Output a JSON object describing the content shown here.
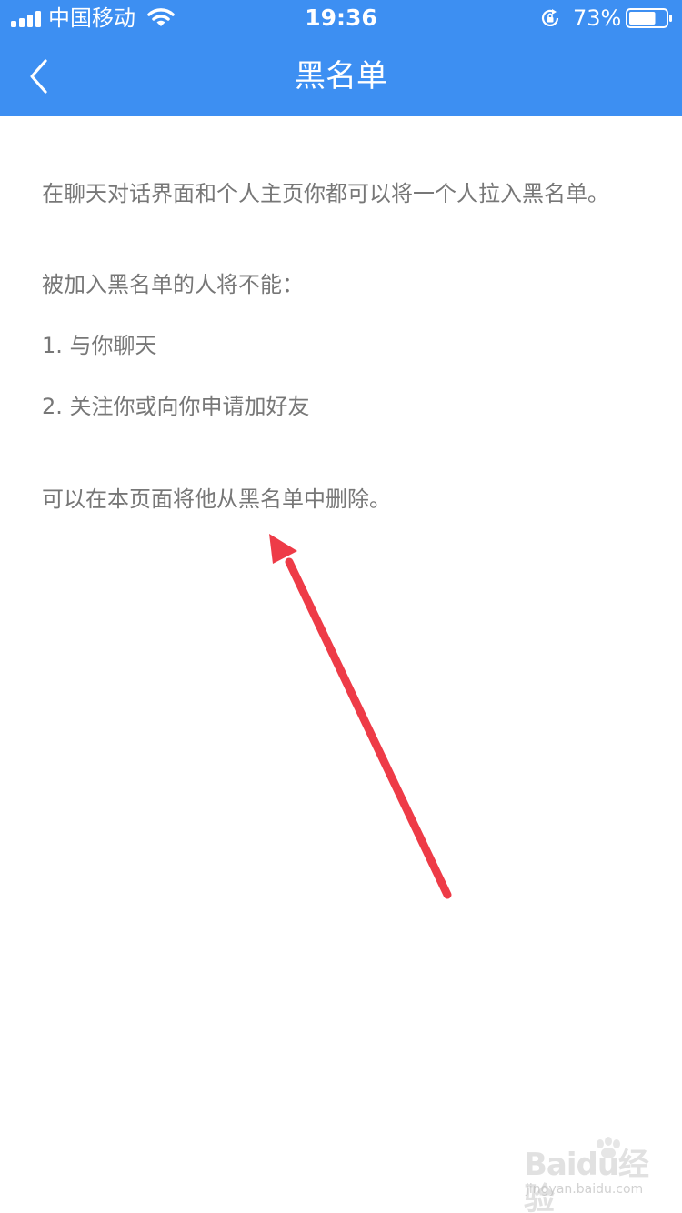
{
  "status_bar": {
    "carrier": "中国移动",
    "time": "19:36",
    "battery_percent": "73%",
    "battery_level": 0.73,
    "icons": [
      "signal-icon",
      "wifi-icon",
      "rotation-lock-icon",
      "battery-icon"
    ]
  },
  "nav": {
    "title": "黑名单",
    "back_icon": "chevron-left-icon"
  },
  "content": {
    "intro": "在聊天对话界面和个人主页你都可以将一个人拉入黑名单。",
    "restrictions_heading": "被加入黑名单的人将不能：",
    "restrictions": [
      "1. 与你聊天",
      "2. 关注你或向你申请加好友"
    ],
    "removal_note": "可以在本页面将他从黑名单中删除。"
  },
  "annotation": {
    "arrow_color": "#ee3b47"
  },
  "watermark": {
    "brand": "Baidu经验",
    "url": "jingyan.baidu.com"
  },
  "colors": {
    "accent": "#3d8ff2",
    "body_text": "#777777",
    "background": "#ffffff"
  }
}
